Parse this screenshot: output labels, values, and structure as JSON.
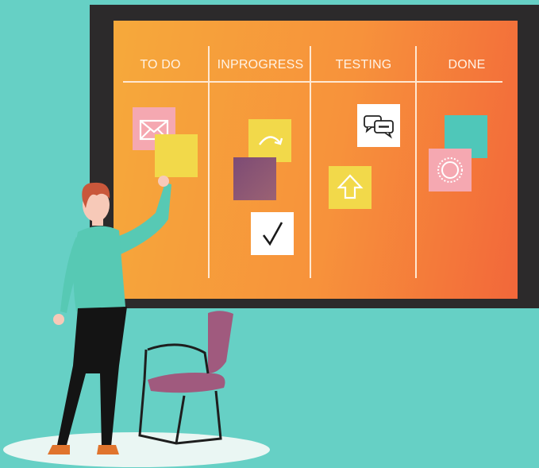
{
  "board": {
    "columns": [
      {
        "label": "TO DO"
      },
      {
        "label": "INPROGRESS"
      },
      {
        "label": "TESTING"
      },
      {
        "label": "DONE"
      }
    ]
  },
  "notes": [
    {
      "column": "TO DO",
      "icon": "envelope-icon",
      "color": "#f5a8b1"
    },
    {
      "column": "TO DO",
      "icon": "blank",
      "color": "#f2d94a"
    },
    {
      "column": "INPROGRESS",
      "icon": "curved-arrow-icon",
      "color": "#f2d94a"
    },
    {
      "column": "INPROGRESS",
      "icon": "blank",
      "color": "#8a5573"
    },
    {
      "column": "INPROGRESS",
      "icon": "checkmark-icon",
      "color": "#ffffff"
    },
    {
      "column": "TESTING",
      "icon": "chat-bubbles-icon",
      "color": "#ffffff"
    },
    {
      "column": "TESTING",
      "icon": "up-arrow-icon",
      "color": "#f2d94a"
    },
    {
      "column": "DONE",
      "icon": "blank",
      "color": "#4fc7b9"
    },
    {
      "column": "DONE",
      "icon": "sun-badge-icon",
      "color": "#f5a8b1"
    }
  ],
  "colors": {
    "background": "#66d0c5",
    "frame": "#2c2a2b",
    "board_gradient_start": "#f6a93b",
    "board_gradient_end": "#f2673a"
  }
}
